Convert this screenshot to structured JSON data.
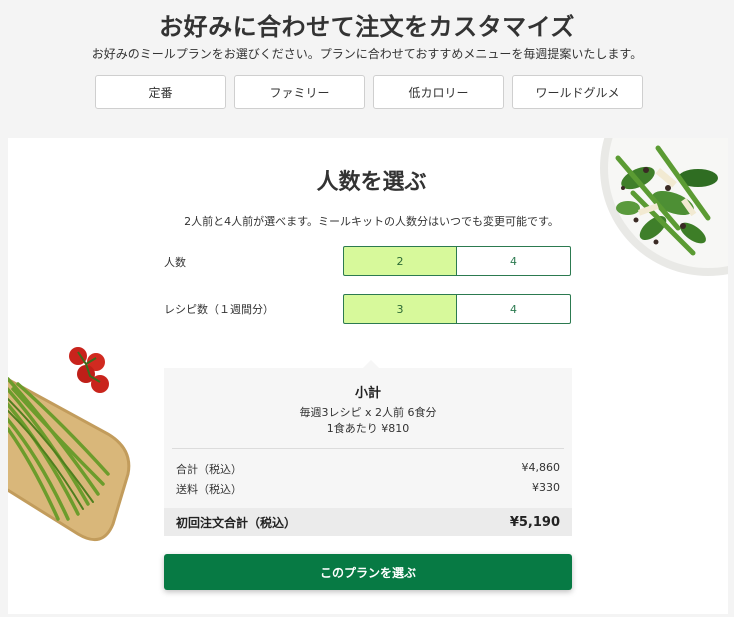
{
  "header": {
    "title": "お好みに合わせて注文をカスタマイズ",
    "subtitle": "お好みのミールプランをお選びください。プランに合わせておすすめメニューを毎週提案いたします。"
  },
  "plan_tabs": [
    "定番",
    "ファミリー",
    "低カロリー",
    "ワールドグルメ"
  ],
  "card": {
    "title": "人数を選ぶ",
    "note": "2人前と4人前が選べます。ミールキットの人数分はいつでも変更可能です。",
    "people": {
      "label": "人数",
      "options": [
        "2",
        "4"
      ],
      "selected": "2"
    },
    "recipes": {
      "label": "レシピ数（１週間分）",
      "options": [
        "3",
        "4"
      ],
      "selected": "3"
    }
  },
  "summary": {
    "title": "小計",
    "detail": "毎週3レシピ x 2人前 6食分",
    "per_meal": "1食あたり ¥810",
    "subtotal_label": "合計（税込）",
    "subtotal_value": "¥4,860",
    "shipping_label": "送料（税込）",
    "shipping_value": "¥330",
    "total_label": "初回注文合計（税込）",
    "total_value": "¥5,190"
  },
  "cta_label": "このプランを選ぶ",
  "colors": {
    "accent": "#077a44",
    "selected_bg": "#d7f99b",
    "outline": "#2c7a50",
    "page_bg": "#f4f4f4"
  },
  "icons": [
    "salad-plate-image",
    "green-beans-board-image"
  ]
}
